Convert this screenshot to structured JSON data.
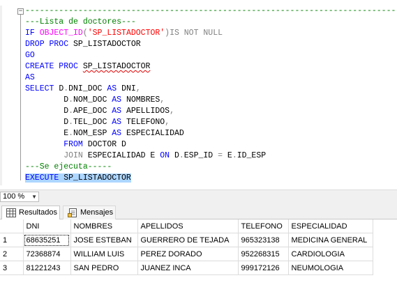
{
  "editor": {
    "lines": [
      {
        "parts": [
          {
            "t": "---------------------------------------------------------------------------------",
            "c": "cm"
          }
        ]
      },
      {
        "parts": [
          {
            "t": "---Lista de doctores---",
            "c": "cm"
          }
        ]
      },
      {
        "parts": [
          {
            "t": "IF ",
            "c": "kw"
          },
          {
            "t": "OBJECT_ID",
            "c": "fn"
          },
          {
            "t": "(",
            "c": "op"
          },
          {
            "t": "'SP_LISTADOCTOR'",
            "c": "st"
          },
          {
            "t": ")",
            "c": "op"
          },
          {
            "t": "IS NOT NULL",
            "c": "op"
          }
        ]
      },
      {
        "parts": [
          {
            "t": "DROP PROC ",
            "c": "kw"
          },
          {
            "t": "SP_LISTADOCTOR",
            "c": ""
          }
        ]
      },
      {
        "parts": [
          {
            "t": "GO",
            "c": "kw"
          }
        ]
      },
      {
        "parts": [
          {
            "t": "CREATE PROC ",
            "c": "kw"
          },
          {
            "t": "SP_LISTADOCTOR",
            "c": "sq"
          }
        ]
      },
      {
        "parts": [
          {
            "t": "AS",
            "c": "kw"
          }
        ]
      },
      {
        "parts": [
          {
            "t": "SELECT ",
            "c": "kw"
          },
          {
            "t": "D",
            "c": ""
          },
          {
            "t": ".",
            "c": "op"
          },
          {
            "t": "DNI_DOC ",
            "c": ""
          },
          {
            "t": "AS ",
            "c": "kw"
          },
          {
            "t": "DNI",
            "c": ""
          },
          {
            "t": ",",
            "c": "op"
          }
        ]
      },
      {
        "parts": [
          {
            "t": "        D",
            "c": ""
          },
          {
            "t": ".",
            "c": "op"
          },
          {
            "t": "NOM_DOC ",
            "c": ""
          },
          {
            "t": "AS ",
            "c": "kw"
          },
          {
            "t": "NOMBRES",
            "c": ""
          },
          {
            "t": ",",
            "c": "op"
          }
        ]
      },
      {
        "parts": [
          {
            "t": "        D",
            "c": ""
          },
          {
            "t": ".",
            "c": "op"
          },
          {
            "t": "APE_DOC ",
            "c": ""
          },
          {
            "t": "AS ",
            "c": "kw"
          },
          {
            "t": "APELLIDOS",
            "c": ""
          },
          {
            "t": ",",
            "c": "op"
          }
        ]
      },
      {
        "parts": [
          {
            "t": "        D",
            "c": ""
          },
          {
            "t": ".",
            "c": "op"
          },
          {
            "t": "TEL_DOC ",
            "c": ""
          },
          {
            "t": "AS ",
            "c": "kw"
          },
          {
            "t": "TELEFONO",
            "c": ""
          },
          {
            "t": ",",
            "c": "op"
          }
        ]
      },
      {
        "parts": [
          {
            "t": "        E",
            "c": ""
          },
          {
            "t": ".",
            "c": "op"
          },
          {
            "t": "NOM_ESP ",
            "c": ""
          },
          {
            "t": "AS ",
            "c": "kw"
          },
          {
            "t": "ESPECIALIDAD",
            "c": ""
          }
        ]
      },
      {
        "parts": [
          {
            "t": "        FROM ",
            "c": "kw"
          },
          {
            "t": "DOCTOR D",
            "c": ""
          }
        ]
      },
      {
        "parts": [
          {
            "t": "        JOIN ",
            "c": "op"
          },
          {
            "t": "ESPECIALIDAD E ",
            "c": ""
          },
          {
            "t": "ON ",
            "c": "kw"
          },
          {
            "t": "D",
            "c": ""
          },
          {
            "t": ".",
            "c": "op"
          },
          {
            "t": "ESP_ID ",
            "c": ""
          },
          {
            "t": "= ",
            "c": "op"
          },
          {
            "t": "E",
            "c": ""
          },
          {
            "t": ".",
            "c": "op"
          },
          {
            "t": "ID_ESP",
            "c": ""
          }
        ]
      },
      {
        "parts": [
          {
            "t": "---Se ejecuta-----",
            "c": "cm"
          }
        ]
      },
      {
        "parts": [
          {
            "t": "EXECUTE ",
            "c": "kw sel"
          },
          {
            "t": "SP_LISTADOCTOR",
            "c": "sel"
          }
        ]
      }
    ]
  },
  "zoom": {
    "value": "100 %"
  },
  "tabs": {
    "results": "Resultados",
    "messages": "Mensajes"
  },
  "grid": {
    "columns": [
      "DNI",
      "NOMBRES",
      "APELLIDOS",
      "TELEFONO",
      "ESPECIALIDAD"
    ],
    "rows": [
      {
        "n": "1",
        "cells": [
          "68635251",
          "JOSE ESTEBAN",
          "GUERRERO DE TEJADA",
          "965323138",
          "MEDICINA GENERAL"
        ]
      },
      {
        "n": "2",
        "cells": [
          "72368874",
          "WILLIAM LUIS",
          "PEREZ DORADO",
          "952268315",
          "CARDIOLOGIA"
        ]
      },
      {
        "n": "3",
        "cells": [
          "81221243",
          "SAN PEDRO",
          "JUANEZ INCA",
          "999172126",
          "NEUMOLOGIA"
        ]
      }
    ]
  }
}
